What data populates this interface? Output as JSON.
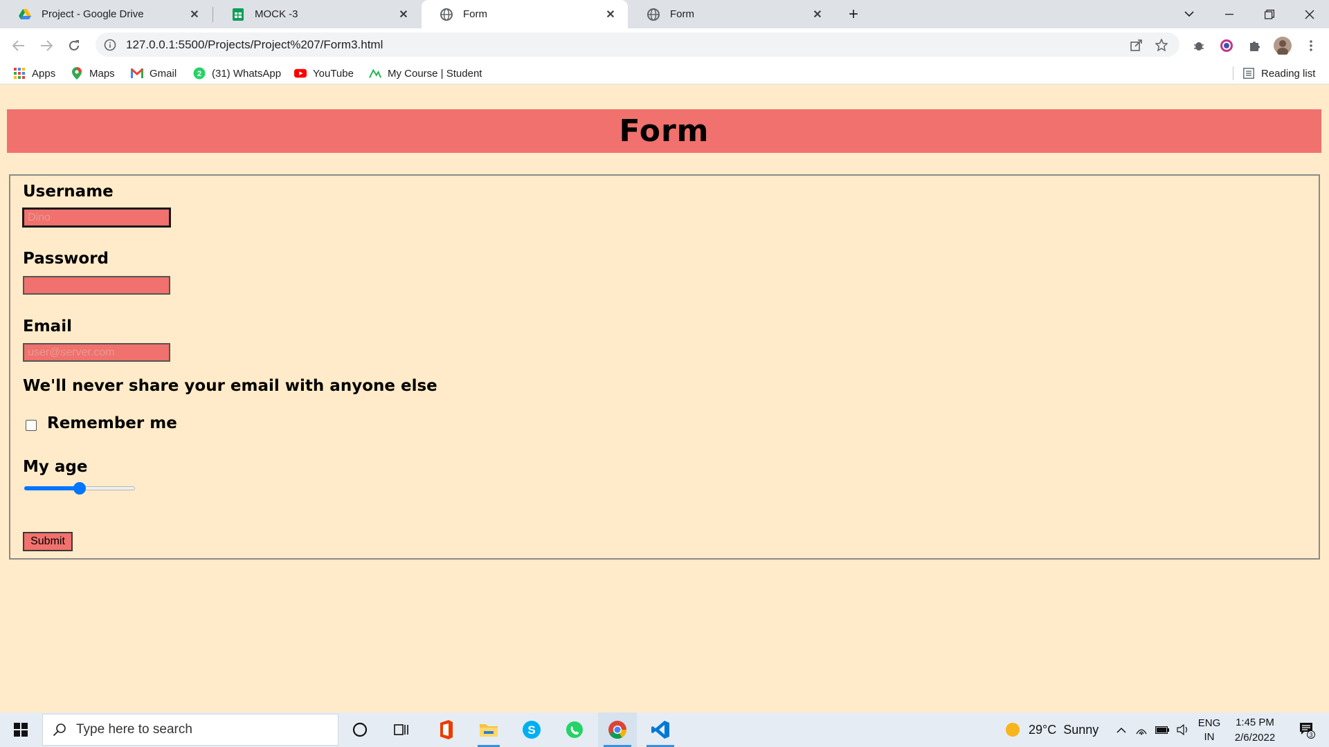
{
  "browser": {
    "tabs": [
      {
        "title": "Project - Google Drive",
        "icon": "google-drive-icon",
        "active": false
      },
      {
        "title": "MOCK -3",
        "icon": "google-sheets-icon",
        "active": false
      },
      {
        "title": "Form",
        "icon": "globe-icon",
        "active": true
      },
      {
        "title": "Form",
        "icon": "globe-icon",
        "active": false
      }
    ],
    "url": "127.0.0.1:5500/Projects/Project%207/Form3.html",
    "bookmarks": [
      {
        "label": "Apps",
        "icon": "apps-grid-icon"
      },
      {
        "label": "Maps",
        "icon": "maps-pin-icon"
      },
      {
        "label": "Gmail",
        "icon": "gmail-icon"
      },
      {
        "label": "(31) WhatsApp",
        "icon": "whatsapp-badge-icon"
      },
      {
        "label": "YouTube",
        "icon": "youtube-icon"
      },
      {
        "label": "My Course | Student",
        "icon": "course-icon"
      }
    ],
    "reading_list": "Reading list"
  },
  "form": {
    "heading": "Form",
    "username_label": "Username",
    "username_placeholder": "Dino",
    "password_label": "Password",
    "email_label": "Email",
    "email_placeholder": "user@server.com",
    "privacy_note": "We'll never share your email with anyone else",
    "remember_label": "Remember me",
    "remember_checked": false,
    "age_label": "My age",
    "age_slider_fraction": 0.5,
    "submit_label": "Submit"
  },
  "taskbar": {
    "search_placeholder": "Type here to search",
    "weather": "29°C  Sunny",
    "lang_top": "ENG",
    "lang_bottom": "IN",
    "time": "1:45 PM",
    "date": "2/6/2022",
    "notification_count": "3"
  },
  "colors": {
    "page_bg": "#ffebc9",
    "accent": "#f0716d",
    "slider": "#0075ff"
  }
}
